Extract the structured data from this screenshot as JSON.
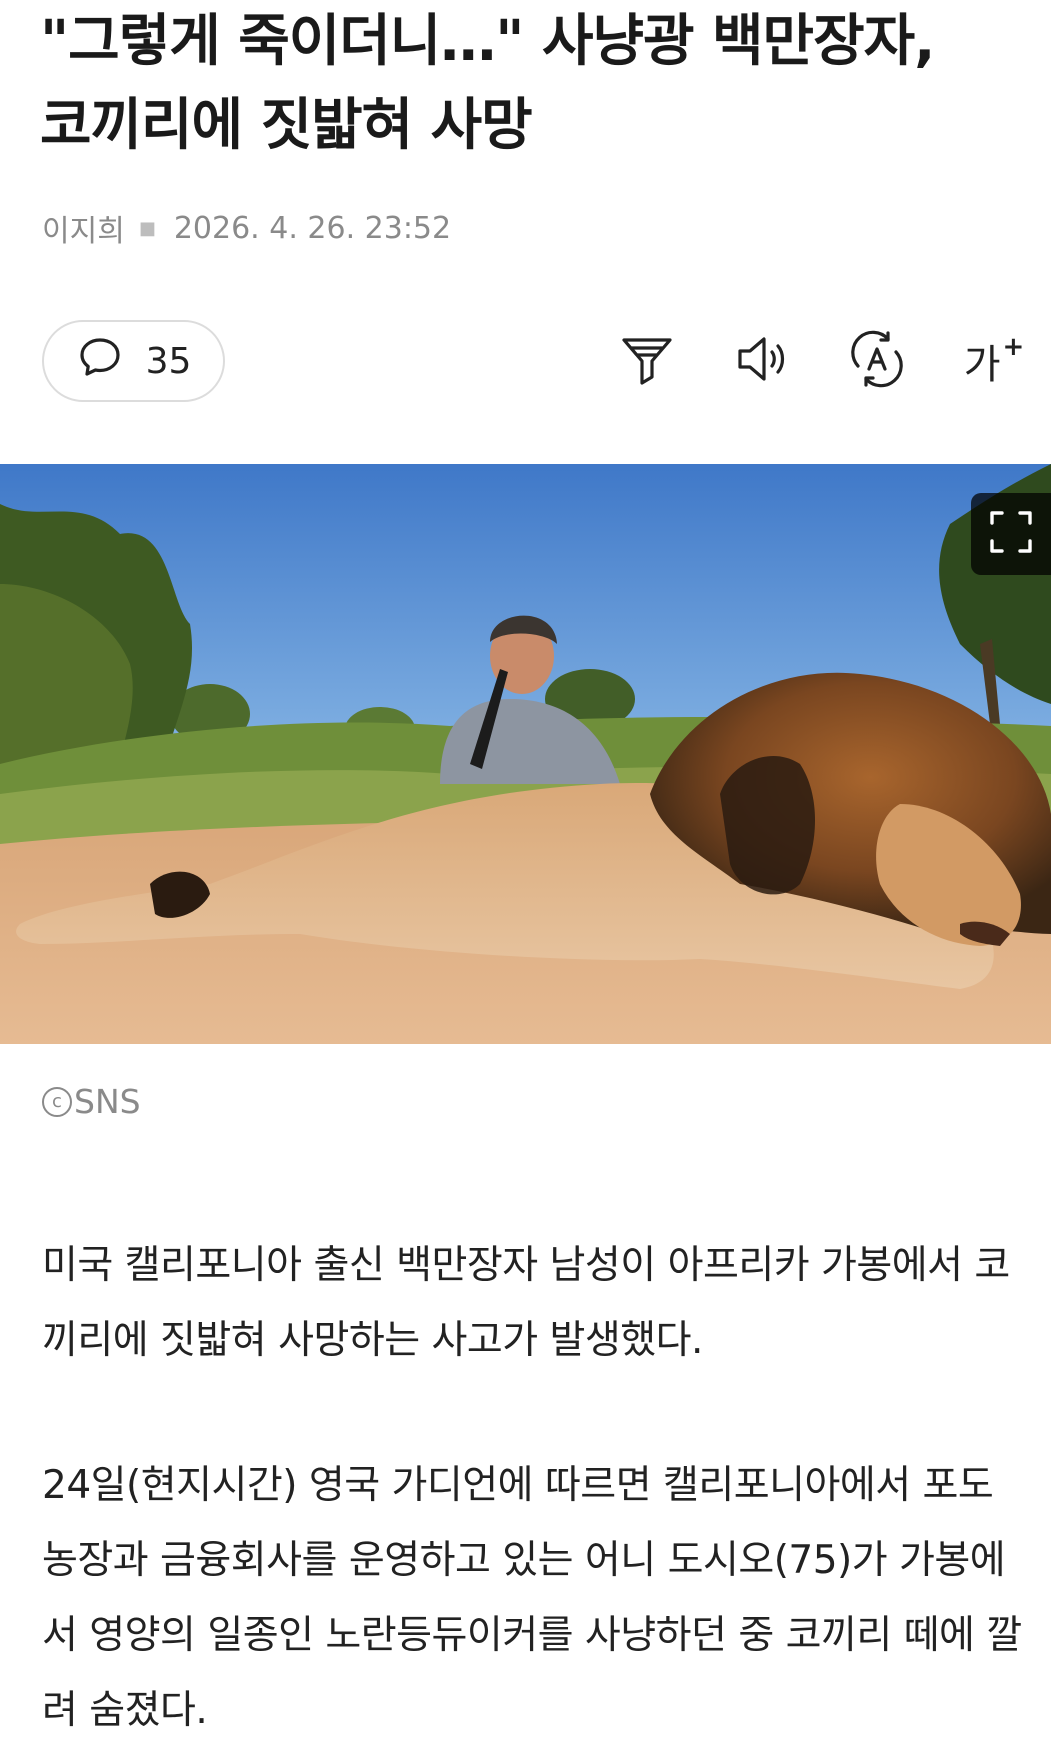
{
  "article": {
    "title": "\"그렇게 죽이더니…\" 사냥광 백만장자, 코끼리에 짓밟혀 사망",
    "author": "이지희",
    "date": "2026. 4. 26. 23:52"
  },
  "toolbar": {
    "comment_count": "35",
    "comment_icon": "speech-bubble-icon",
    "filter_icon": "filter-icon",
    "speaker_icon": "speaker-icon",
    "translate_icon": "translate-icon",
    "font_size_label": "가",
    "font_size_plus": "+"
  },
  "image": {
    "credit": "SNS",
    "credit_symbol": "c",
    "expand_icon": "expand-icon"
  },
  "body": {
    "p1": "미국 캘리포니아 출신 백만장자 남성이 아프리카 가봉에서 코끼리에 짓밟혀 사망하는 사고가 발생했다.",
    "p2": "24일(현지시간) 영국 가디언에 따르면 캘리포니아에서 포도 농장과 금융회사를 운영하고 있는 어니 도시오(75)가 가봉에서 영양의 일종인 노란등듀이커를 사냥하던 중 코끼리 떼에 깔려 숨졌다."
  }
}
